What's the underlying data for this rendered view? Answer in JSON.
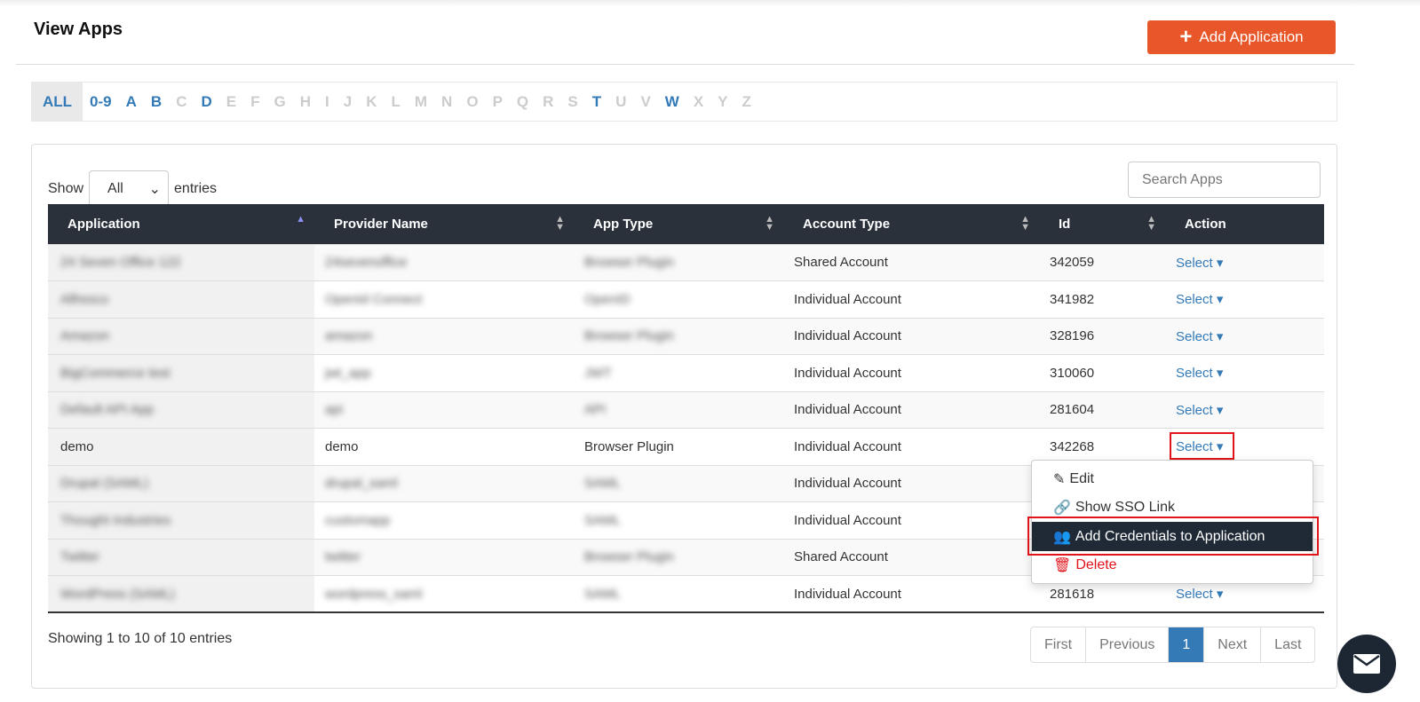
{
  "header": {
    "title": "View Apps",
    "add_button": "Add Application"
  },
  "alphabet": [
    "ALL",
    "0-9",
    "A",
    "B",
    "C",
    "D",
    "E",
    "F",
    "G",
    "H",
    "I",
    "J",
    "K",
    "L",
    "M",
    "N",
    "O",
    "P",
    "Q",
    "R",
    "S",
    "T",
    "U",
    "V",
    "W",
    "X",
    "Y",
    "Z"
  ],
  "alphabet_active": [
    "ALL",
    "0-9",
    "A",
    "B",
    "D",
    "T",
    "W"
  ],
  "controls": {
    "show_label": "Show",
    "show_value": "All",
    "entries_label": "entries",
    "search_placeholder": "Search Apps"
  },
  "table": {
    "columns": [
      "Application",
      "Provider Name",
      "App Type",
      "Account Type",
      "Id",
      "Action"
    ],
    "rows": [
      {
        "app": "24 Seven Office 122",
        "provider": "24sevenoffice",
        "type": "Browser Plugin",
        "account": "Shared Account",
        "id": "342059",
        "action": "Select",
        "blurred": true
      },
      {
        "app": "Alfresco",
        "provider": "OpenId Connect",
        "type": "OpenID",
        "account": "Individual Account",
        "id": "341982",
        "action": "Select",
        "blurred": true
      },
      {
        "app": "Amazon",
        "provider": "amazon",
        "type": "Browser Plugin",
        "account": "Individual Account",
        "id": "328196",
        "action": "Select",
        "blurred": true
      },
      {
        "app": "BigCommerce test",
        "provider": "jwt_app",
        "type": "JWT",
        "account": "Individual Account",
        "id": "310060",
        "action": "Select",
        "blurred": true
      },
      {
        "app": "Default API App",
        "provider": "api",
        "type": "API",
        "account": "Individual Account",
        "id": "281604",
        "action": "Select",
        "blurred": true
      },
      {
        "app": "demo",
        "provider": "demo",
        "type": "Browser Plugin",
        "account": "Individual Account",
        "id": "342268",
        "action": "Select",
        "blurred": false
      },
      {
        "app": "Drupal (SAML)",
        "provider": "drupal_saml",
        "type": "SAML",
        "account": "Individual Account",
        "id": "",
        "action": "",
        "blurred": true
      },
      {
        "app": "Thought Industries",
        "provider": "customapp",
        "type": "SAML",
        "account": "Individual Account",
        "id": "",
        "action": "",
        "blurred": true
      },
      {
        "app": "Twitter",
        "provider": "twitter",
        "type": "Browser Plugin",
        "account": "Shared Account",
        "id": "",
        "action": "",
        "blurred": true
      },
      {
        "app": "WordPress (SAML)",
        "provider": "wordpress_saml",
        "type": "SAML",
        "account": "Individual Account",
        "id": "281618",
        "action": "Select",
        "blurred": true
      }
    ]
  },
  "dropdown": {
    "items": [
      {
        "label": "Edit",
        "icon": "edit-icon"
      },
      {
        "label": "Show SSO Link",
        "icon": "link-icon"
      },
      {
        "label": "Add Credentials to Application",
        "icon": "users-icon"
      },
      {
        "label": "Delete",
        "icon": "trash-icon"
      }
    ]
  },
  "footer": {
    "info": "Showing 1 to 10 of 10 entries",
    "pagination": [
      "First",
      "Previous",
      "1",
      "Next",
      "Last"
    ],
    "current_page": "1"
  },
  "colors": {
    "accent": "#e8572a",
    "header_bg": "#2a313b",
    "link": "#337ab7",
    "danger": "#e0141a"
  }
}
